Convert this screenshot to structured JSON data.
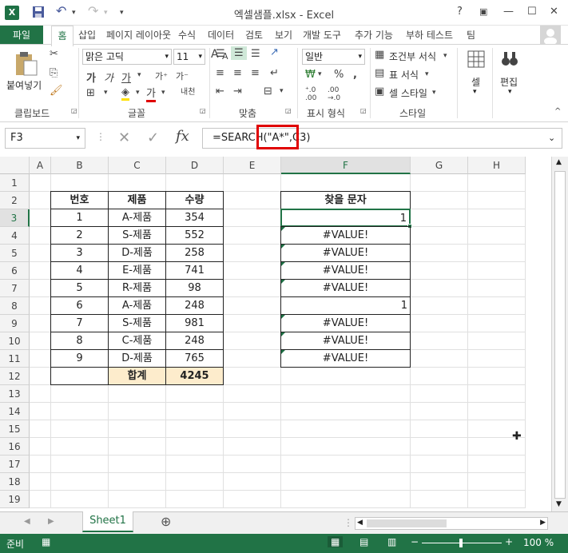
{
  "window": {
    "title": "엑셀샘플.xlsx - Excel",
    "help": "?",
    "minimize": "—",
    "restore": "☐",
    "close": "✕"
  },
  "ribbon_tabs": [
    "파일",
    "홈",
    "삽입",
    "페이지 레이아웃",
    "수식",
    "데이터",
    "검토",
    "보기",
    "개발 도구",
    "추가 기능",
    "부하 테스트",
    "팀"
  ],
  "ribbon": {
    "clipboard": {
      "paste": "붙여넣기",
      "label": "클립보드"
    },
    "font": {
      "name": "맑은 고딕",
      "size": "11",
      "label": "글꼴"
    },
    "alignment": {
      "label": "맞춤"
    },
    "number": {
      "format": "일반",
      "label": "표시 형식"
    },
    "styles": {
      "conditional": "조건부 서식",
      "table": "표 서식",
      "cell_style": "셀 스타일",
      "label": "스타일"
    },
    "cells": {
      "label": "셀"
    },
    "editing": {
      "label": "편집"
    }
  },
  "namebox": "F3",
  "formula": "=SEARCH(\"A*\",C3)",
  "columns": [
    "A",
    "B",
    "C",
    "D",
    "E",
    "F",
    "G",
    "H"
  ],
  "rows": [
    "1",
    "2",
    "3",
    "4",
    "5",
    "6",
    "7",
    "8",
    "9",
    "10",
    "11",
    "12",
    "13",
    "14",
    "15",
    "16",
    "17",
    "18",
    "19"
  ],
  "table": {
    "headers": [
      "번호",
      "제품",
      "수량"
    ],
    "rows": [
      [
        "1",
        "A-제품",
        "354"
      ],
      [
        "2",
        "S-제품",
        "552"
      ],
      [
        "3",
        "D-제품",
        "258"
      ],
      [
        "4",
        "E-제품",
        "741"
      ],
      [
        "5",
        "R-제품",
        "98"
      ],
      [
        "6",
        "A-제품",
        "248"
      ],
      [
        "7",
        "S-제품",
        "981"
      ],
      [
        "8",
        "C-제품",
        "248"
      ],
      [
        "9",
        "D-제품",
        "765"
      ]
    ],
    "total_label": "합계",
    "total_value": "4245"
  },
  "search_col": {
    "header": "찾을 문자",
    "values": [
      "1",
      "#VALUE!",
      "#VALUE!",
      "#VALUE!",
      "#VALUE!",
      "1",
      "#VALUE!",
      "#VALUE!",
      "#VALUE!"
    ]
  },
  "sheet_tab": "Sheet1",
  "status": {
    "mode": "준비",
    "zoom": "100 %"
  }
}
